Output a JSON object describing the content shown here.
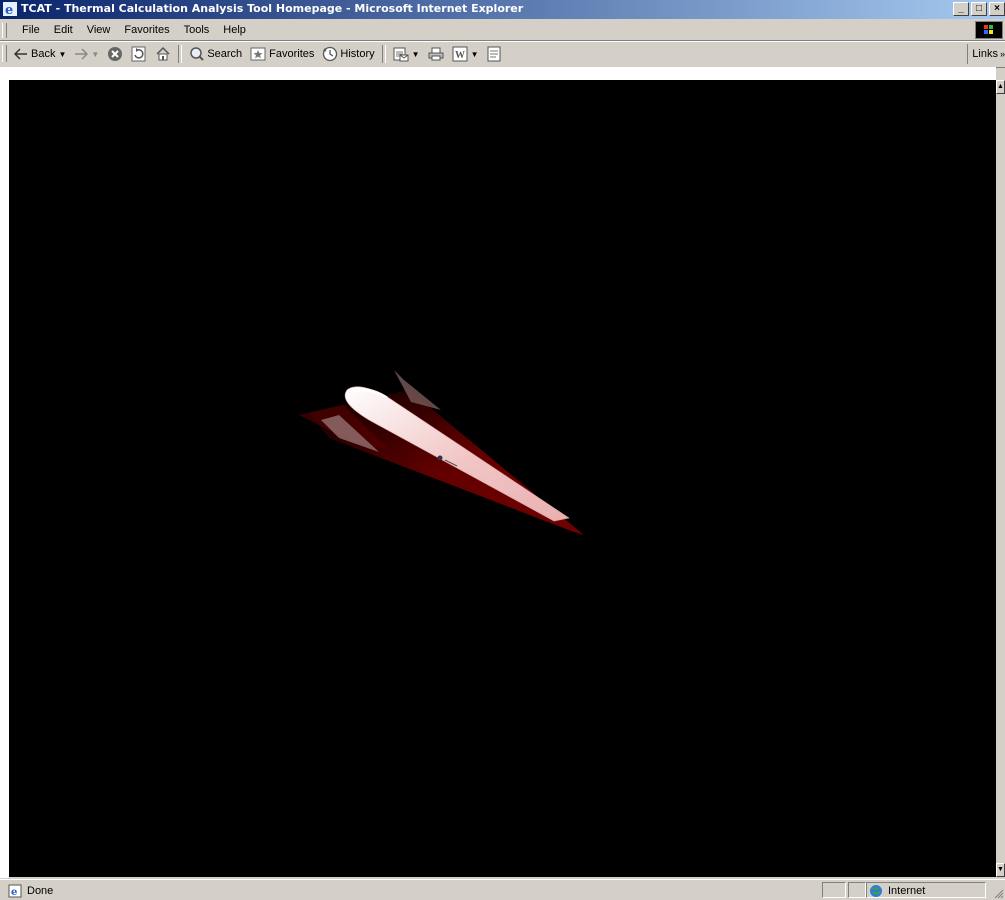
{
  "window": {
    "title": "TCAT - Thermal Calculation Analysis Tool Homepage - Microsoft Internet Explorer",
    "controls": [
      "_",
      "□",
      "×"
    ]
  },
  "menu": {
    "items": [
      {
        "label": "File"
      },
      {
        "label": "Edit"
      },
      {
        "label": "View"
      },
      {
        "label": "Favorites"
      },
      {
        "label": "Tools"
      },
      {
        "label": "Help"
      }
    ]
  },
  "toolbar": {
    "back_label": "Back",
    "search_label": "Search",
    "favorites_label": "Favorites",
    "history_label": "History",
    "links_label": "Links"
  },
  "content": {
    "background": "#000000",
    "image": "spaceplane-render"
  },
  "status": {
    "text": "Done",
    "zone": "Internet"
  },
  "colors": {
    "title_start": "#0a246a",
    "title_end": "#a6caf0",
    "chrome": "#d4d0c8",
    "heat_glow": "#8b0000"
  }
}
